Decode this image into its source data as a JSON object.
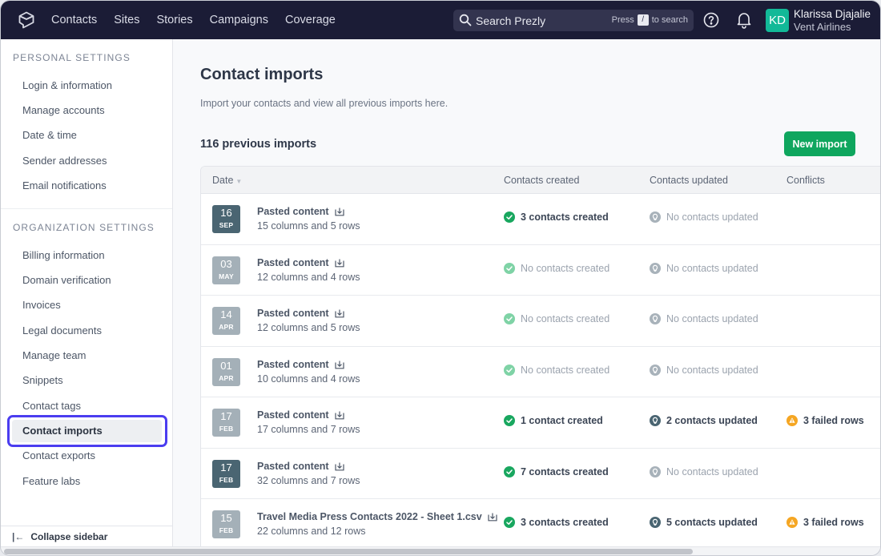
{
  "topbar": {
    "logo": "prezly-logo-icon",
    "nav": [
      "Contacts",
      "Sites",
      "Stories",
      "Campaigns",
      "Coverage"
    ],
    "search": {
      "placeholder": "Search Prezly",
      "hint_before": "Press",
      "hint_key": "/",
      "hint_after": "to search"
    },
    "user": {
      "initials": "KD",
      "name": "Klarissa Djajalie",
      "organization": "Vent Airlines",
      "avatar_color": "#12b998"
    }
  },
  "sidebar": {
    "personal_title": "PERSONAL SETTINGS",
    "personal_items": [
      "Login & information",
      "Manage accounts",
      "Date & time",
      "Sender addresses",
      "Email notifications"
    ],
    "org_title": "ORGANIZATION SETTINGS",
    "org_items": [
      "Billing information",
      "Domain verification",
      "Invoices",
      "Legal documents",
      "Manage team",
      "Snippets",
      "Contact tags",
      "Contact imports",
      "Contact exports",
      "Feature labs"
    ],
    "active_item": "Contact imports",
    "collapse_label": "Collapse sidebar"
  },
  "main": {
    "title": "Contact imports",
    "subtitle": "Import your contacts and view all previous imports here.",
    "count_label": "116 previous imports",
    "new_import_label": "New import",
    "columns": {
      "date": "Date",
      "created": "Contacts created",
      "updated": "Contacts updated",
      "conflicts": "Conflicts"
    },
    "rows": [
      {
        "day": "16",
        "month": "SEP",
        "date_style": "dark",
        "name": "Pasted content",
        "meta": "15 columns and 5 rows",
        "created": "3 contacts created",
        "created_active": true,
        "updated": "No contacts updated",
        "updated_active": false,
        "conflicts": ""
      },
      {
        "day": "03",
        "month": "MAY",
        "date_style": "light",
        "name": "Pasted content",
        "meta": "12 columns and 4 rows",
        "created": "No contacts created",
        "created_active": false,
        "updated": "No contacts updated",
        "updated_active": false,
        "conflicts": ""
      },
      {
        "day": "14",
        "month": "APR",
        "date_style": "light",
        "name": "Pasted content",
        "meta": "12 columns and 5 rows",
        "created": "No contacts created",
        "created_active": false,
        "updated": "No contacts updated",
        "updated_active": false,
        "conflicts": ""
      },
      {
        "day": "01",
        "month": "APR",
        "date_style": "light",
        "name": "Pasted content",
        "meta": "10 columns and 4 rows",
        "created": "No contacts created",
        "created_active": false,
        "updated": "No contacts updated",
        "updated_active": false,
        "conflicts": ""
      },
      {
        "day": "17",
        "month": "FEB",
        "date_style": "light",
        "name": "Pasted content",
        "meta": "17 columns and 7 rows",
        "created": "1 contact created",
        "created_active": true,
        "updated": "2 contacts updated",
        "updated_active": true,
        "conflicts": "3 failed rows"
      },
      {
        "day": "17",
        "month": "FEB",
        "date_style": "dark",
        "name": "Pasted content",
        "meta": "32 columns and 7 rows",
        "created": "7 contacts created",
        "created_active": true,
        "updated": "No contacts updated",
        "updated_active": false,
        "conflicts": ""
      },
      {
        "day": "15",
        "month": "FEB",
        "date_style": "light",
        "name": "Travel Media Press Contacts 2022 - Sheet 1.csv",
        "meta": "22 columns and 12 rows",
        "created": "3 contacts created",
        "created_active": true,
        "updated": "5 contacts updated",
        "updated_active": true,
        "conflicts": "3 failed rows"
      }
    ]
  },
  "colors": {
    "topbar": "#1b1c36",
    "accent": "#4b3df0",
    "success": "#0fa65e",
    "warning": "#f5a623",
    "updated": "#4a6572"
  }
}
